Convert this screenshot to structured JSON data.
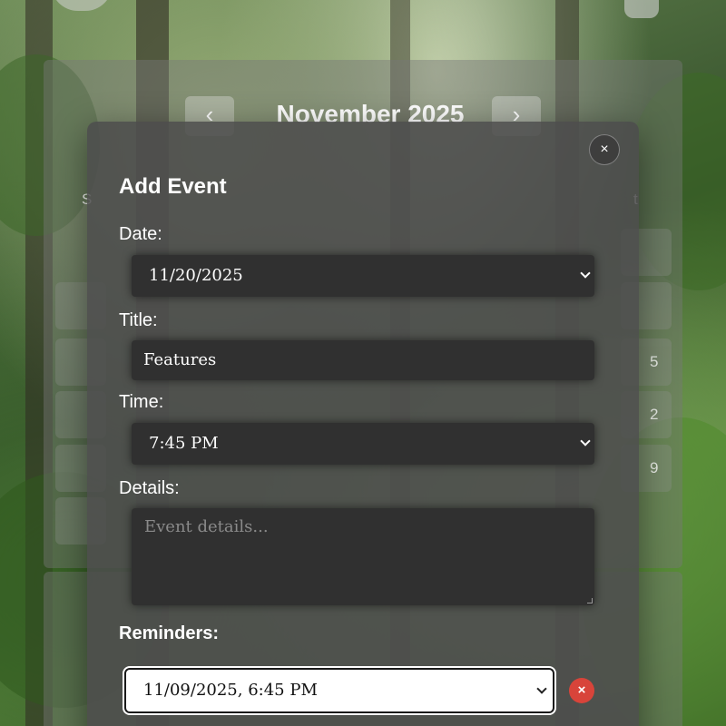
{
  "calendar": {
    "prev_icon": "chevron-left-icon",
    "next_icon": "chevron-right-icon",
    "prev_glyph": "‹",
    "next_glyph": "›",
    "month_title": "November 2025",
    "weekday_first": "S",
    "weekday_last": "t",
    "visible_days": [
      "5",
      "2",
      "9"
    ]
  },
  "modal": {
    "close_glyph": "×",
    "close_icon": "close-icon",
    "heading": "Add Event",
    "date_label": "Date:",
    "date_value": "11/20/2025",
    "title_label": "Title:",
    "title_value": "Features",
    "time_label": "Time:",
    "time_value": "7:45 PM",
    "details_label": "Details:",
    "details_placeholder": "Event details...",
    "reminders_label": "Reminders:",
    "reminder_value": "11/09/2025, 6:45 PM",
    "remove_glyph": "×",
    "remove_icon": "remove-reminder-icon"
  },
  "colors": {
    "modal_bg": "#4c4c4c",
    "field_bg": "#303030",
    "remove_button": "#d8443a"
  }
}
